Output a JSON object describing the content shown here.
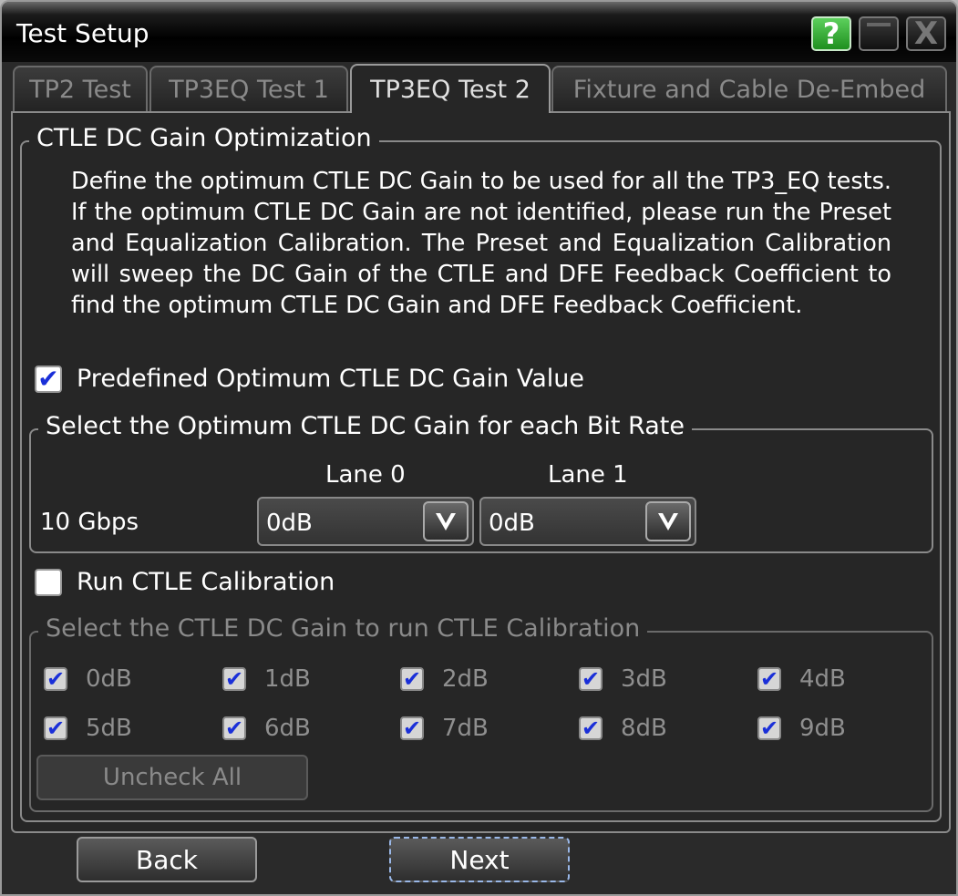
{
  "window": {
    "title": "Test Setup",
    "help_label": "?",
    "close_label": "X"
  },
  "tabs": [
    {
      "label": "TP2 Test",
      "active": false
    },
    {
      "label": "TP3EQ Test 1",
      "active": false
    },
    {
      "label": "TP3EQ Test 2",
      "active": true
    },
    {
      "label": "Fixture and Cable De-Embed",
      "active": false
    }
  ],
  "ctle_group": {
    "legend": "CTLE DC Gain Optimization",
    "description": "Define the optimum CTLE DC Gain to be used for all the TP3_EQ tests. If the optimum CTLE DC Gain are not identified, please run the Preset and Equalization Calibration. The Preset and Equalization Calibration will sweep the DC Gain of the CTLE and DFE Feedback Coefficient to find the optimum CTLE DC Gain and DFE Feedback Coefficient.",
    "predefined_checkbox": {
      "label": "Predefined Optimum CTLE DC Gain Value",
      "checked": true
    },
    "optimum_group": {
      "legend": "Select the Optimum CTLE DC Gain for each Bit Rate",
      "lane0_header": "Lane 0",
      "lane1_header": "Lane 1",
      "row_label": "10 Gbps",
      "lane0_value": "0dB",
      "lane1_value": "0dB"
    },
    "run_calibration_checkbox": {
      "label": "Run CTLE Calibration",
      "checked": false
    },
    "calibration_group": {
      "legend": "Select the CTLE DC Gain to run CTLE Calibration",
      "gains": [
        {
          "label": "0dB",
          "checked": true
        },
        {
          "label": "1dB",
          "checked": true
        },
        {
          "label": "2dB",
          "checked": true
        },
        {
          "label": "3dB",
          "checked": true
        },
        {
          "label": "4dB",
          "checked": true
        },
        {
          "label": "5dB",
          "checked": true
        },
        {
          "label": "6dB",
          "checked": true
        },
        {
          "label": "7dB",
          "checked": true
        },
        {
          "label": "8dB",
          "checked": true
        },
        {
          "label": "9dB",
          "checked": true
        }
      ],
      "uncheck_all_label": "Uncheck All"
    }
  },
  "footer": {
    "back_label": "Back",
    "next_label": "Next"
  },
  "colors": {
    "checkmark": "#1a2fd8",
    "help_button": "#2fa82f",
    "panel_bg": "#262626"
  }
}
